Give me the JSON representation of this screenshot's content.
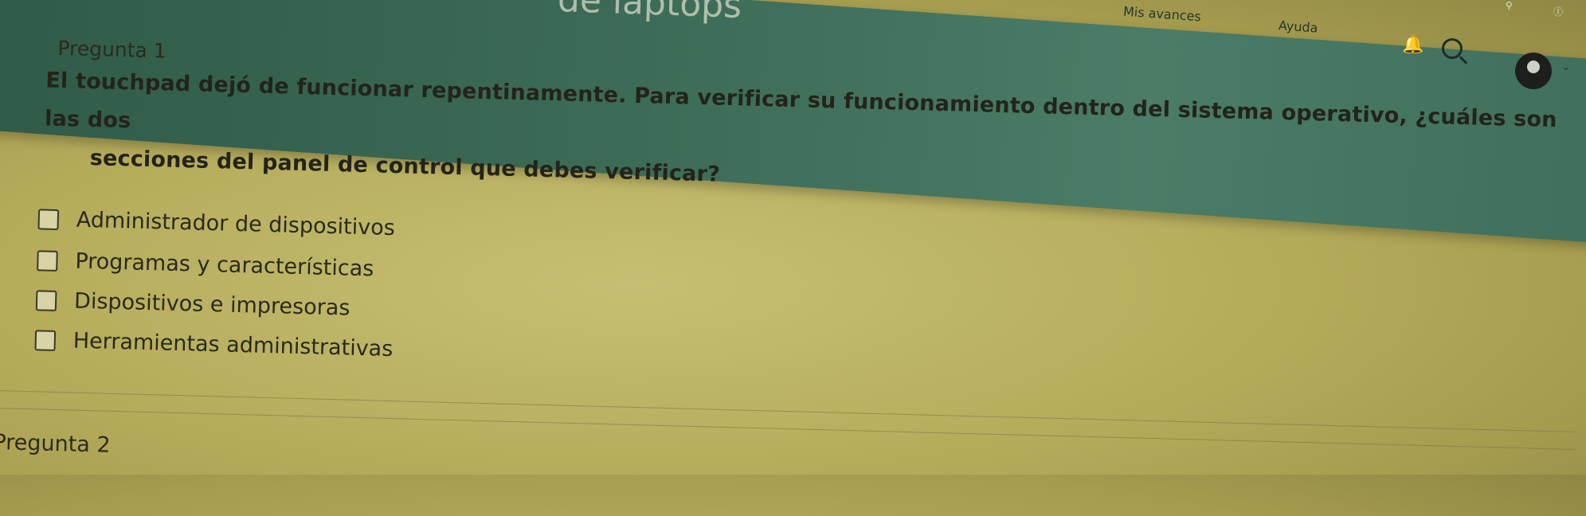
{
  "header": {
    "brand": "de laptops",
    "nav": {
      "progress": "Mis avances",
      "help": "Ayuda"
    },
    "small_icons": [
      "⚲",
      "Ⓘ"
    ]
  },
  "questions": [
    {
      "label": "Pregunta 1",
      "text_line1": "El touchpad dejó de funcionar repentinamente. Para verificar su funcionamiento dentro del sistema operativo, ¿cuáles son las dos",
      "text_line2": "secciones del panel de control que debes verificar?",
      "options": [
        "Administrador de dispositivos",
        "Programas y características",
        "Dispositivos e impresoras",
        "Herramientas administrativas"
      ]
    },
    {
      "label": "Pregunta 2"
    }
  ],
  "colors": {
    "header_green": "#3c6b57",
    "page_bg": "#b6ad5c",
    "text": "#24231a"
  },
  "icons": [
    "bell-icon",
    "search-icon",
    "avatar-icon",
    "chevron-down-icon",
    "checkbox-icon"
  ]
}
